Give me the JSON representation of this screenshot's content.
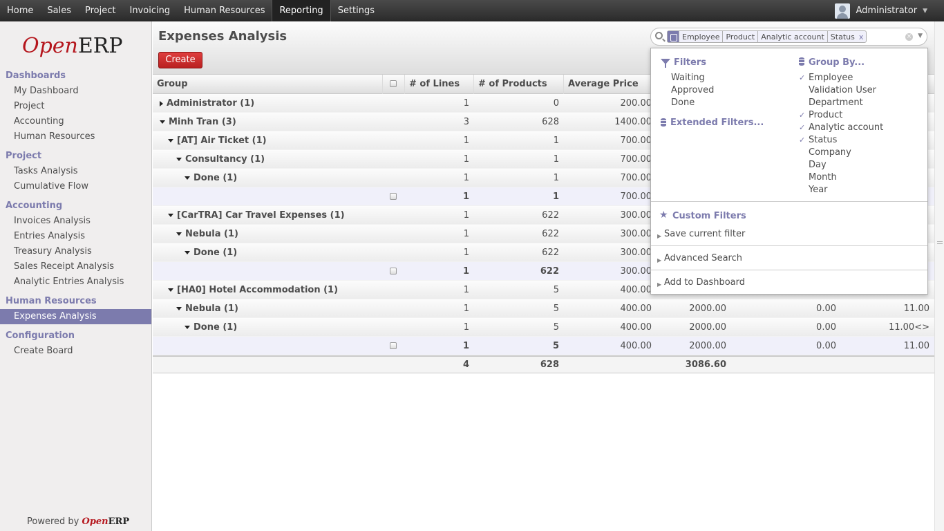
{
  "topbar": {
    "menu": [
      "Home",
      "Sales",
      "Project",
      "Invoicing",
      "Human Resources",
      "Reporting",
      "Settings"
    ],
    "active": "Reporting",
    "user": "Administrator"
  },
  "logo": {
    "open": "Open",
    "erp": "ERP"
  },
  "sidebar": {
    "sections": [
      {
        "title": "Dashboards",
        "items": [
          "My Dashboard",
          "Project",
          "Accounting",
          "Human Resources"
        ]
      },
      {
        "title": "Project",
        "items": [
          "Tasks Analysis",
          "Cumulative Flow"
        ]
      },
      {
        "title": "Accounting",
        "items": [
          "Invoices Analysis",
          "Entries Analysis",
          "Treasury Analysis",
          "Sales Receipt Analysis",
          "Analytic Entries Analysis"
        ]
      },
      {
        "title": "Human Resources",
        "items": [
          "Expenses Analysis"
        ]
      },
      {
        "title": "Configuration",
        "items": [
          "Create Board"
        ]
      }
    ],
    "active_item": "Expenses Analysis",
    "powered_by": "Powered by"
  },
  "header": {
    "title": "Expenses Analysis",
    "create_label": "Create"
  },
  "search": {
    "facet_values": [
      "Employee",
      "Product",
      "Analytic account",
      "Status"
    ],
    "facet_remove": "x",
    "filters_title": "Filters",
    "filters": [
      "Waiting",
      "Approved",
      "Done"
    ],
    "extended_filters": "Extended Filters...",
    "group_by_title": "Group By...",
    "group_by": [
      {
        "label": "Employee",
        "checked": true
      },
      {
        "label": "Validation User",
        "checked": false
      },
      {
        "label": "Department",
        "checked": false
      },
      {
        "label": "Product",
        "checked": true
      },
      {
        "label": "Analytic account",
        "checked": true
      },
      {
        "label": "Status",
        "checked": true
      },
      {
        "label": "Company",
        "checked": false
      },
      {
        "label": "Day",
        "checked": false
      },
      {
        "label": "Month",
        "checked": false
      },
      {
        "label": "Year",
        "checked": false
      }
    ],
    "custom_filters": "Custom Filters",
    "save_filter": "Save current filter",
    "advanced_search": "Advanced Search",
    "add_dashboard": "Add to Dashboard"
  },
  "table": {
    "headers": [
      "Group",
      "# of Lines",
      "# of Products",
      "Average Price"
    ],
    "rows": [
      {
        "type": "group",
        "level": 0,
        "open": false,
        "label": "Administrator (1)",
        "lines": "1",
        "products": "0",
        "avg": "200.00",
        "c5": "",
        "c6": "",
        "c7": ""
      },
      {
        "type": "group",
        "level": 0,
        "open": true,
        "label": "Minh Tran (3)",
        "lines": "3",
        "products": "628",
        "avg": "1400.00",
        "c5": "",
        "c6": "",
        "c7": ""
      },
      {
        "type": "group",
        "level": 1,
        "open": true,
        "label": "[AT] Air Ticket (1)",
        "lines": "1",
        "products": "1",
        "avg": "700.00",
        "c5": "",
        "c6": "",
        "c7": ""
      },
      {
        "type": "group",
        "level": 2,
        "open": true,
        "label": "Consultancy (1)",
        "lines": "1",
        "products": "1",
        "avg": "700.00",
        "c5": "",
        "c6": "",
        "c7": ""
      },
      {
        "type": "group",
        "level": 3,
        "open": true,
        "label": "Done (1)",
        "lines": "1",
        "products": "1",
        "avg": "700.00",
        "c5": "",
        "c6": "",
        "c7": ""
      },
      {
        "type": "record",
        "lines": "1",
        "products": "1",
        "avg": "700.00",
        "c5": "",
        "c6": "",
        "c7": ""
      },
      {
        "type": "group",
        "level": 1,
        "open": true,
        "label": "[CarTRA] Car Travel Expenses (1)",
        "lines": "1",
        "products": "622",
        "avg": "300.00",
        "c5": "",
        "c6": "",
        "c7": ""
      },
      {
        "type": "group",
        "level": 2,
        "open": true,
        "label": "Nebula (1)",
        "lines": "1",
        "products": "622",
        "avg": "300.00",
        "c5": "",
        "c6": "",
        "c7": ""
      },
      {
        "type": "group",
        "level": 3,
        "open": true,
        "label": "Done (1)",
        "lines": "1",
        "products": "622",
        "avg": "300.00",
        "c5": "",
        "c6": "",
        "c7": ""
      },
      {
        "type": "record",
        "lines": "1",
        "products": "622",
        "avg": "300.00",
        "c5": "",
        "c6": "",
        "c7": ""
      },
      {
        "type": "group",
        "level": 1,
        "open": true,
        "label": "[HA0] Hotel Accommodation (1)",
        "lines": "1",
        "products": "5",
        "avg": "400.00",
        "c5": "",
        "c6": "",
        "c7": ""
      },
      {
        "type": "group",
        "level": 2,
        "open": true,
        "label": "Nebula (1)",
        "lines": "1",
        "products": "5",
        "avg": "400.00",
        "c5": "2000.00",
        "c6": "0.00",
        "c7": "11.00"
      },
      {
        "type": "group",
        "level": 3,
        "open": true,
        "label": "Done (1)",
        "lines": "1",
        "products": "5",
        "avg": "400.00",
        "c5": "2000.00",
        "c6": "0.00",
        "c7": "11.00<>"
      },
      {
        "type": "record",
        "lines": "1",
        "products": "5",
        "avg": "400.00",
        "c5": "2000.00",
        "c6": "0.00",
        "c7": "11.00"
      }
    ],
    "footer": {
      "lines": "4",
      "products": "628",
      "c5": "3086.60"
    }
  }
}
